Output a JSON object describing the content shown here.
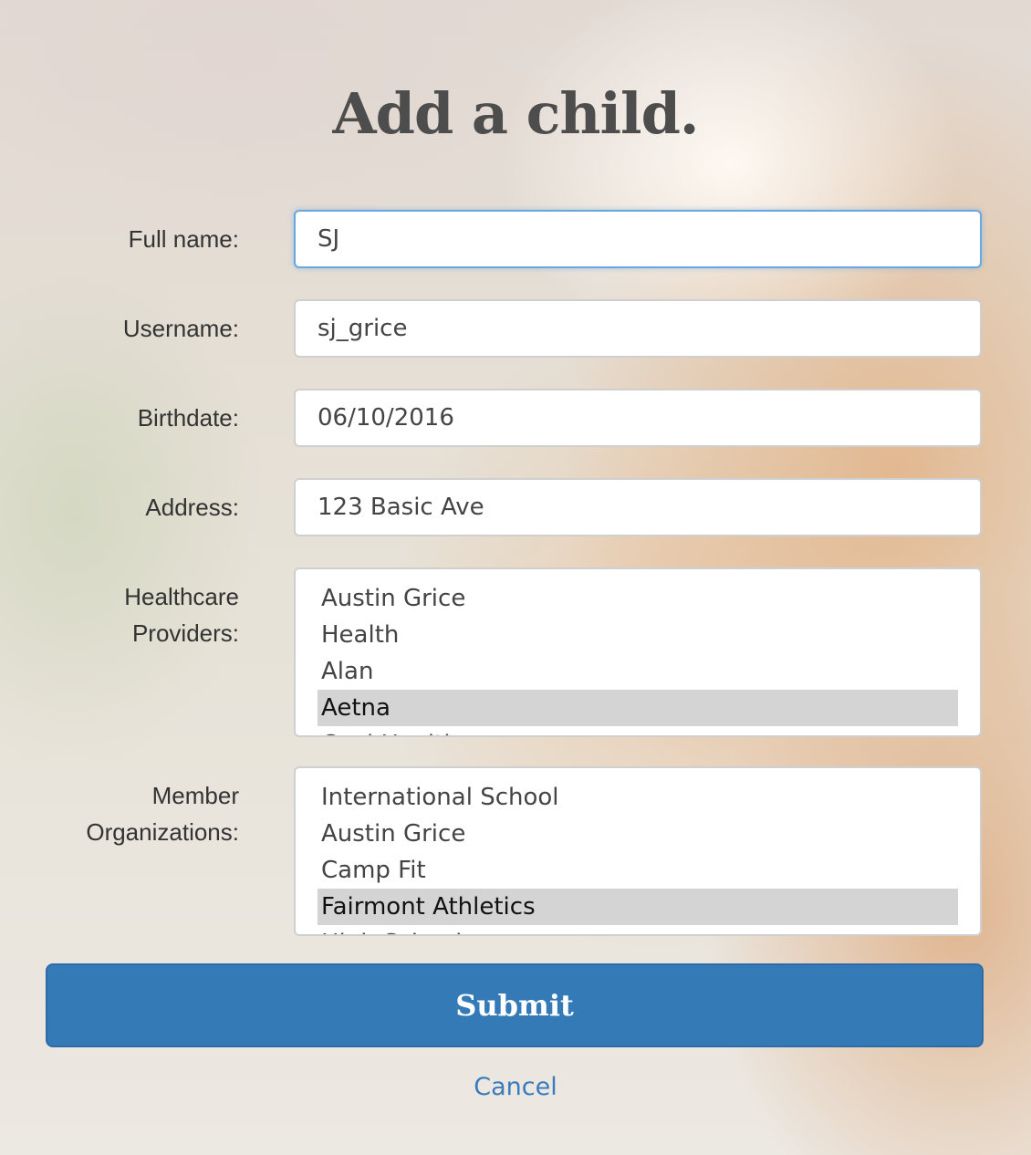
{
  "title": "Add a child.",
  "form": {
    "full_name": {
      "label": "Full name:",
      "value": "SJ"
    },
    "username": {
      "label": "Username:",
      "value": "sj_grice"
    },
    "birthdate": {
      "label": "Birthdate:",
      "value": "06/10/2016"
    },
    "address": {
      "label": "Address:",
      "value": "123 Basic Ave"
    },
    "healthcare_providers": {
      "label_line1": "Healthcare",
      "label_line2": "Providers:",
      "options": [
        "Austin Grice",
        "Health",
        "Alan",
        "Aetna",
        "Cool Health"
      ],
      "selected": "Aetna"
    },
    "member_organizations": {
      "label_line1": "Member",
      "label_line2": "Organizations:",
      "options": [
        "International School",
        "Austin Grice",
        "Camp Fit",
        "Fairmont Athletics",
        "High School"
      ],
      "selected": "Fairmont Athletics"
    }
  },
  "actions": {
    "submit_label": "Submit",
    "cancel_label": "Cancel"
  },
  "colors": {
    "primary": "#337ab7",
    "link": "#3a7bbf",
    "selected_option_bg": "#d4d4d4",
    "focus_border": "#6aa7de"
  }
}
